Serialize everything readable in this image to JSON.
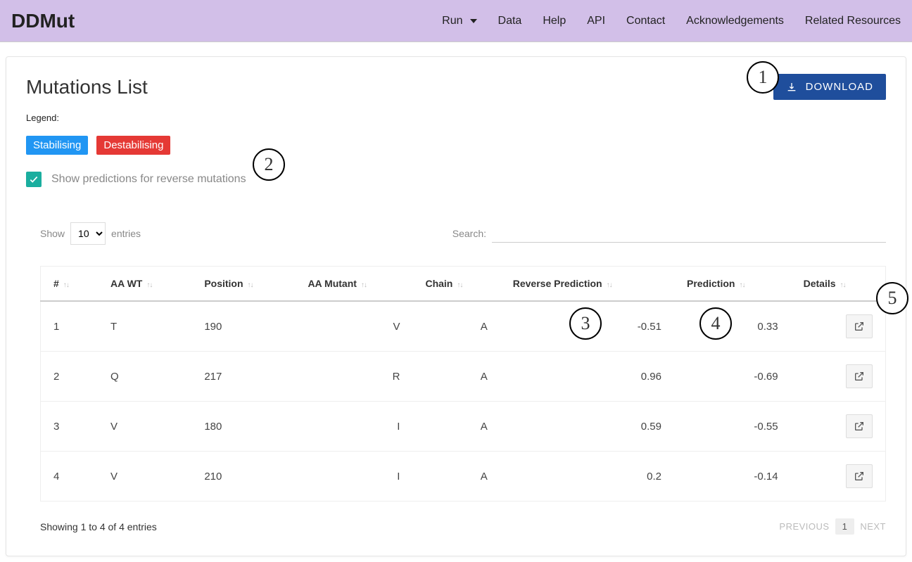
{
  "nav": {
    "brand": "DDMut",
    "items": [
      "Run",
      "Data",
      "Help",
      "API",
      "Contact",
      "Acknowledgements",
      "Related Resources"
    ]
  },
  "page": {
    "title": "Mutations List",
    "download_label": "DOWNLOAD",
    "legend_label": "Legend:",
    "badge_stab": "Stabilising",
    "badge_destab": "Destabilising",
    "checkbox_label": "Show predictions for reverse mutations",
    "checkbox_checked": true
  },
  "table_controls": {
    "show_label": "Show",
    "entries_label": "entries",
    "entries_value": "10",
    "search_label": "Search:"
  },
  "columns": {
    "idx": "#",
    "aawt": "AA WT",
    "pos": "Position",
    "aamut": "AA Mutant",
    "chain": "Chain",
    "rev": "Reverse Prediction",
    "pred": "Prediction",
    "details": "Details"
  },
  "rows": [
    {
      "idx": "1",
      "aawt": "T",
      "pos": "190",
      "aamut": "V",
      "chain": "A",
      "rev": "-0.51",
      "pred": "0.33",
      "pred_class": "stab"
    },
    {
      "idx": "2",
      "aawt": "Q",
      "pos": "217",
      "aamut": "R",
      "chain": "A",
      "rev": "0.96",
      "pred": "-0.69",
      "pred_class": "destab"
    },
    {
      "idx": "3",
      "aawt": "V",
      "pos": "180",
      "aamut": "I",
      "chain": "A",
      "rev": "0.59",
      "pred": "-0.55",
      "pred_class": "destab"
    },
    {
      "idx": "4",
      "aawt": "V",
      "pos": "210",
      "aamut": "I",
      "chain": "A",
      "rev": "0.2",
      "pred": "-0.14",
      "pred_class": "destab"
    }
  ],
  "footer": {
    "info": "Showing 1 to 4 of 4 entries",
    "prev": "PREVIOUS",
    "page": "1",
    "next": "NEXT"
  },
  "annotations": [
    "1",
    "2",
    "3",
    "4",
    "5"
  ]
}
